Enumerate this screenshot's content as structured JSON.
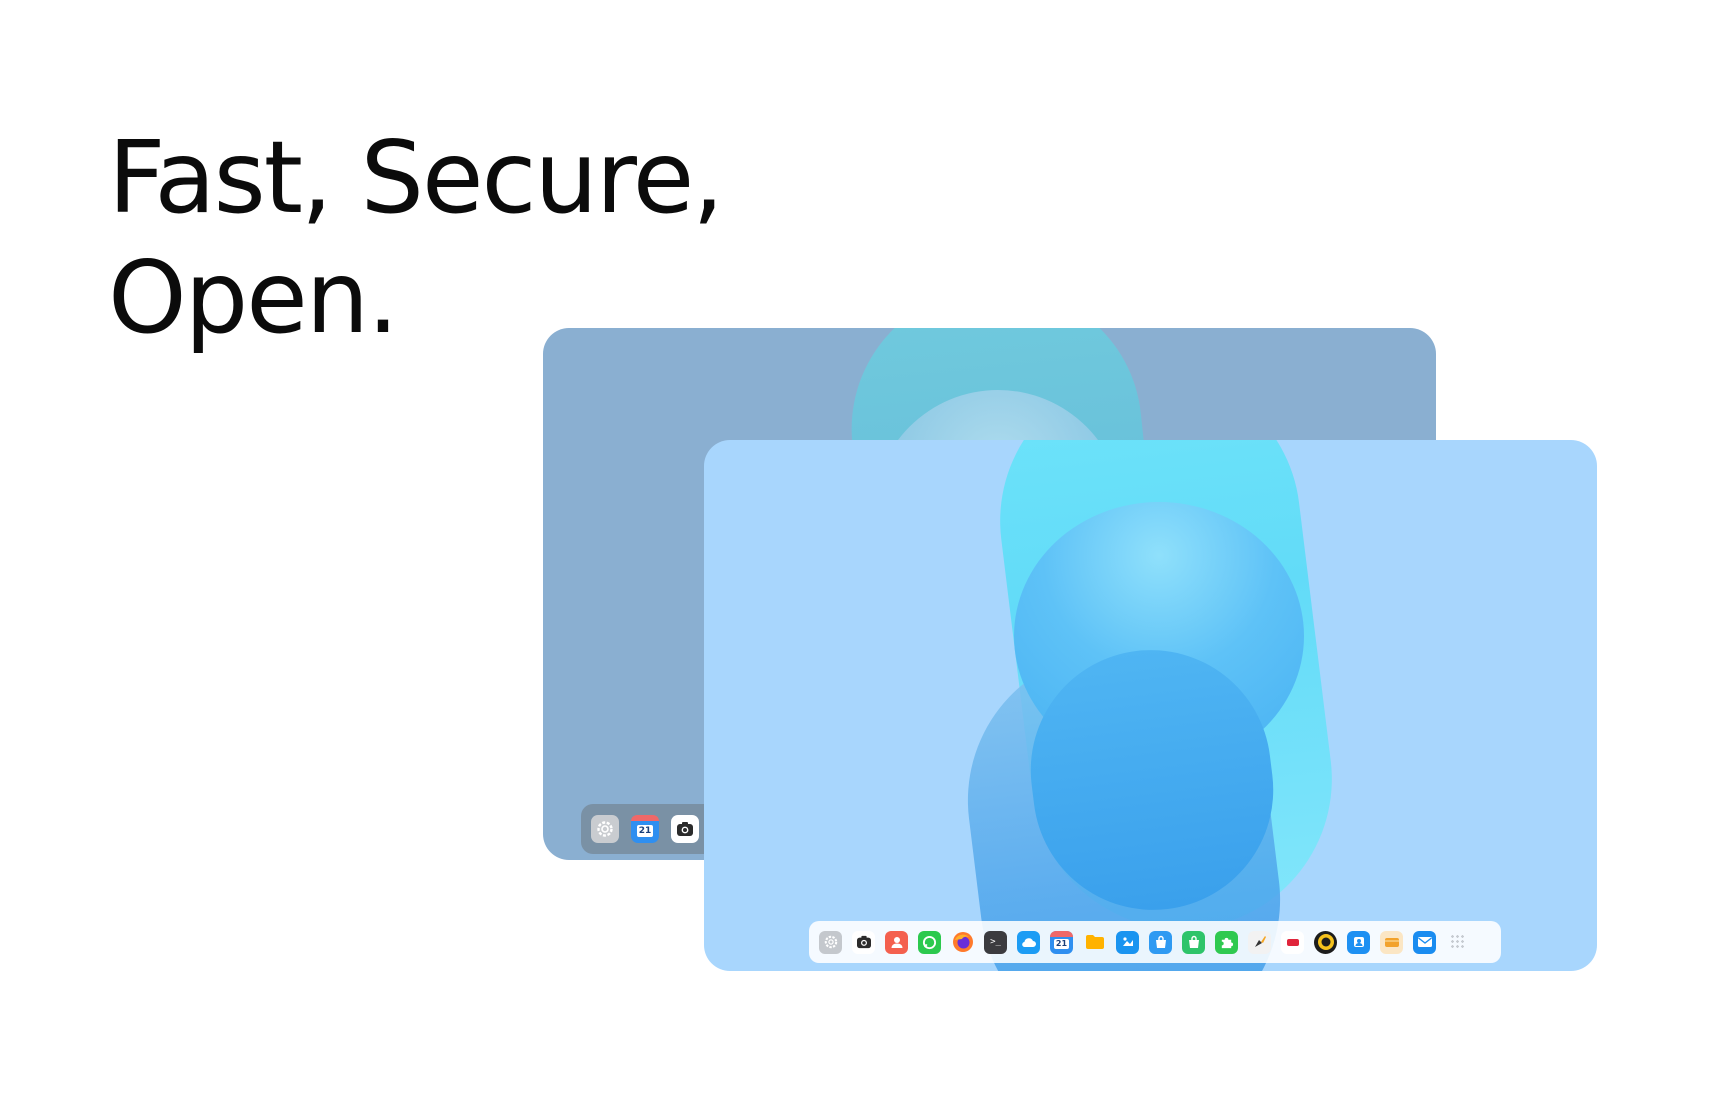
{
  "headline": {
    "line1": "Fast, Secure,",
    "line2": "Open."
  },
  "back_window": {
    "dock_icons": [
      "settings-icon",
      "calendar-icon",
      "camera-icon"
    ],
    "calendar_day": "21"
  },
  "front_window": {
    "dock_icons": [
      "settings-icon",
      "camera-icon",
      "contacts-icon",
      "messages-icon",
      "firefox-icon",
      "terminal-icon",
      "weather-icon",
      "calendar-icon",
      "files-icon",
      "photos-icon",
      "store-icon",
      "android-store-icon",
      "extensions-icon",
      "paint-icon",
      "notes-icon",
      "music-icon",
      "profile-icon",
      "wallet-icon",
      "mail-icon",
      "app-grid-icon"
    ],
    "calendar_day": "21"
  },
  "colors": {
    "back_bg": "#8aafd1",
    "front_bg": "#a8d6fd",
    "headline": "#0b0b0b"
  }
}
